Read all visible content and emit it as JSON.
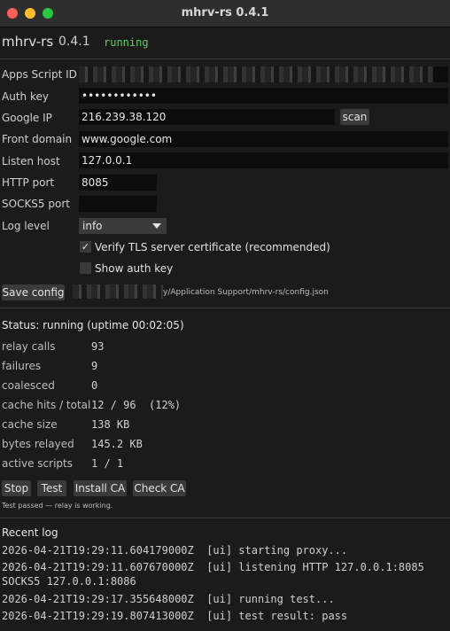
{
  "window": {
    "title": "mhrv-rs 0.4.1"
  },
  "header": {
    "app_name": "mhrv-rs",
    "version": "0.4.1",
    "state": "running"
  },
  "form": {
    "apps_script_id_label": "Apps Script ID",
    "auth_key_label": "Auth key",
    "auth_key_value": "••••••••••••",
    "google_ip_label": "Google IP",
    "google_ip_value": "216.239.38.120",
    "scan_label": "scan",
    "front_domain_label": "Front domain",
    "front_domain_value": "www.google.com",
    "listen_host_label": "Listen host",
    "listen_host_value": "127.0.0.1",
    "http_port_label": "HTTP port",
    "http_port_value": "8085",
    "socks5_port_label": "SOCKS5 port",
    "socks5_port_value": "",
    "log_level_label": "Log level",
    "log_level_value": "info",
    "verify_tls_label": "Verify TLS server certificate (recommended)",
    "verify_tls_checked": true,
    "verify_tls_mark": "✓",
    "show_auth_key_label": "Show auth key",
    "show_auth_key_checked": false,
    "save_config_label": "Save config",
    "config_path": "y/Application Support/mhrv-rs/config.json"
  },
  "status": {
    "title": "Status: running  (uptime 00:02:05)",
    "stats": [
      {
        "label": "relay calls",
        "value": "93"
      },
      {
        "label": "failures",
        "value": "9"
      },
      {
        "label": "coalesced",
        "value": "0"
      },
      {
        "label": "cache hits / total",
        "value": "12 / 96  (12%)"
      },
      {
        "label": "cache size",
        "value": "138 KB"
      },
      {
        "label": "bytes relayed",
        "value": "145.2 KB"
      },
      {
        "label": "active scripts",
        "value": "1 / 1"
      }
    ]
  },
  "actions": {
    "stop": "Stop",
    "test": "Test",
    "install_ca": "Install CA",
    "check_ca": "Check CA",
    "note": "Test passed — relay is working."
  },
  "log": {
    "title": "Recent log",
    "lines": [
      "2026-04-21T19:29:11.604179000Z  [ui] starting proxy...",
      "2026-04-21T19:29:11.607670000Z  [ui] listening HTTP 127.0.0.1:8085",
      "SOCKS5 127.0.0.1:8086",
      "2026-04-21T19:29:17.355648000Z  [ui] running test...",
      "2026-04-21T19:29:19.807413000Z  [ui] test result: pass"
    ]
  },
  "colors": {
    "running": "#5fd35f",
    "close": "#ff5f57",
    "minimize": "#febc2e",
    "maximize": "#28c840"
  }
}
